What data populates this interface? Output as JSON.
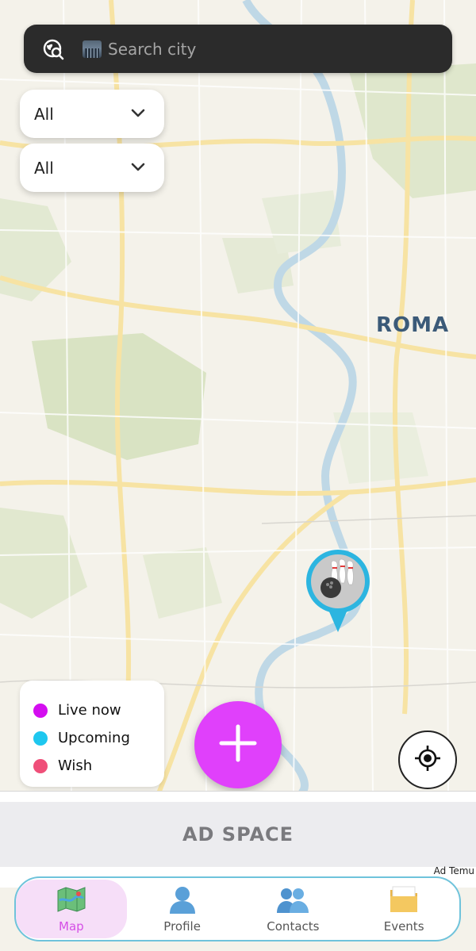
{
  "map": {
    "city_label": "ROMA"
  },
  "search": {
    "placeholder": "Search city",
    "globe_icon": "globe-search-icon",
    "city_icon": "cityscape-icon"
  },
  "filters": [
    {
      "label": "All",
      "icon": "chevron-down-icon"
    },
    {
      "label": "All",
      "icon": "chevron-down-icon"
    }
  ],
  "marker": {
    "icon": "bowling-icon",
    "color": "#2cb5e0"
  },
  "legend": [
    {
      "label": "Live now",
      "color": "#d40ef0"
    },
    {
      "label": "Upcoming",
      "color": "#1ec7ef"
    },
    {
      "label": "Wish",
      "color": "#ef4f79"
    }
  ],
  "fab": {
    "icon": "plus-icon",
    "color": "#e040fb"
  },
  "locate": {
    "icon": "crosshair-icon"
  },
  "ad": {
    "label": "AD SPACE",
    "tag": "Ad Temu"
  },
  "nav": [
    {
      "label": "Map",
      "icon": "map-icon",
      "active": true
    },
    {
      "label": "Profile",
      "icon": "person-icon",
      "active": false
    },
    {
      "label": "Contacts",
      "icon": "people-icon",
      "active": false
    },
    {
      "label": "Events",
      "icon": "folder-icon",
      "active": false
    }
  ],
  "colors": {
    "accent": "#e040fb",
    "nav_border": "#6fc3db",
    "search_bg": "#2b2b2b"
  }
}
